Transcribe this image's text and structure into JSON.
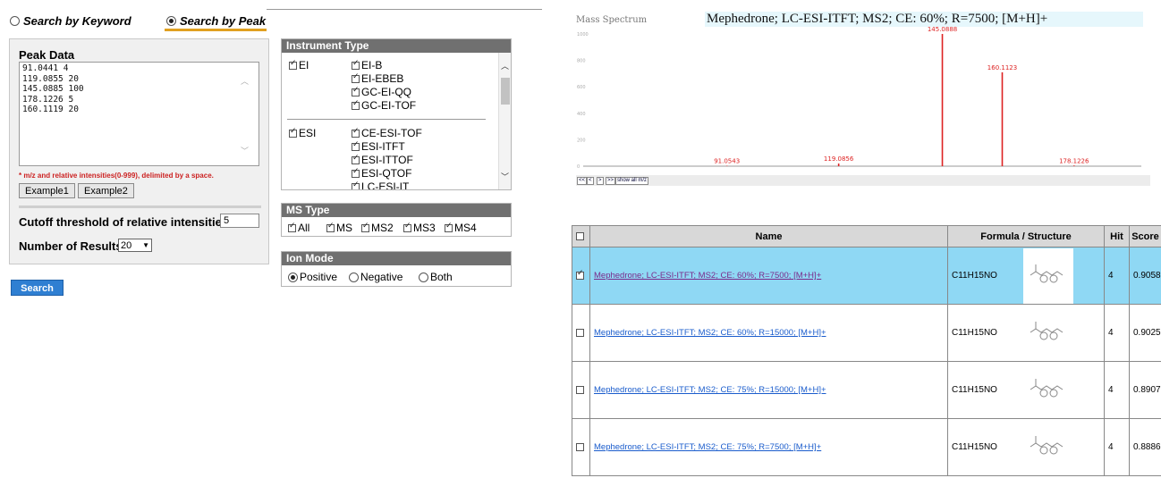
{
  "search_tabs": {
    "keyword_label": "Search by Keyword",
    "peak_label": "Search by Peak"
  },
  "peak_panel": {
    "title": "Peak Data",
    "peaks_text": "91.0441 4\n119.0855 20\n145.0885 100\n178.1226 5\n160.1119 20",
    "note": "* m/z and relative intensities(0-999), delimited by a space.",
    "example1_label": "Example1",
    "example2_label": "Example2",
    "cutoff_label": "Cutoff threshold of relative intensities",
    "cutoff_value": "5",
    "results_label": "Number of Results",
    "results_value": "20",
    "search_label": "Search"
  },
  "instrument_type": {
    "title": "Instrument Type",
    "groups": [
      {
        "label": "EI",
        "checked": true,
        "items": [
          "EI-B",
          "EI-EBEB",
          "GC-EI-QQ",
          "GC-EI-TOF"
        ]
      },
      {
        "label": "ESI",
        "checked": true,
        "items": [
          "CE-ESI-TOF",
          "ESI-ITFT",
          "ESI-ITTOF",
          "ESI-QTOF",
          "LC-ESI-IT"
        ]
      }
    ]
  },
  "ms_type": {
    "title": "MS Type",
    "options": [
      "All",
      "MS",
      "MS2",
      "MS3",
      "MS4"
    ]
  },
  "ion_mode": {
    "title": "Ion Mode",
    "options": [
      "Positive",
      "Negative",
      "Both"
    ],
    "selected": "Positive"
  },
  "spectrum": {
    "panel_label": "Mass Spectrum",
    "title": "Mephedrone; LC-ESI-ITFT; MS2; CE: 60%; R=7500; [M+H]+",
    "nav_buttons": [
      "<<",
      "<",
      ">",
      ">>",
      "show all m/z"
    ],
    "peak_color": "#dd2222"
  },
  "chart_data": {
    "type": "bar",
    "x": [
      91.0543,
      119.0856,
      145.0888,
      160.1123,
      178.1226
    ],
    "values": [
      3,
      20,
      1000,
      710,
      5
    ],
    "peak_labels": [
      "91.0543",
      "119.0856",
      "145.0888",
      "160.1123",
      "178.1226"
    ],
    "ylim": [
      0,
      1000
    ],
    "y_ticks": [
      "0",
      "200",
      "400",
      "600",
      "800",
      "1000"
    ],
    "xlabel": "",
    "ylabel": ""
  },
  "results": {
    "headers": [
      "",
      "Name",
      "Formula / Structure",
      "Hit",
      "Score"
    ],
    "rows": [
      {
        "name": "Mephedrone; LC-ESI-ITFT; MS2; CE: 60%; R=7500; [M+H]+",
        "formula": "C11H15NO",
        "hit": "4",
        "score": "0.9058",
        "checked": true
      },
      {
        "name": "Mephedrone; LC-ESI-ITFT; MS2; CE: 60%; R=15000; [M+H]+",
        "formula": "C11H15NO",
        "hit": "4",
        "score": "0.9025",
        "checked": false
      },
      {
        "name": "Mephedrone; LC-ESI-ITFT; MS2; CE: 75%; R=15000; [M+H]+",
        "formula": "C11H15NO",
        "hit": "4",
        "score": "0.8907",
        "checked": false
      },
      {
        "name": "Mephedrone; LC-ESI-ITFT; MS2; CE: 75%; R=7500; [M+H]+",
        "formula": "C11H15NO",
        "hit": "4",
        "score": "0.8886",
        "checked": false
      }
    ]
  }
}
